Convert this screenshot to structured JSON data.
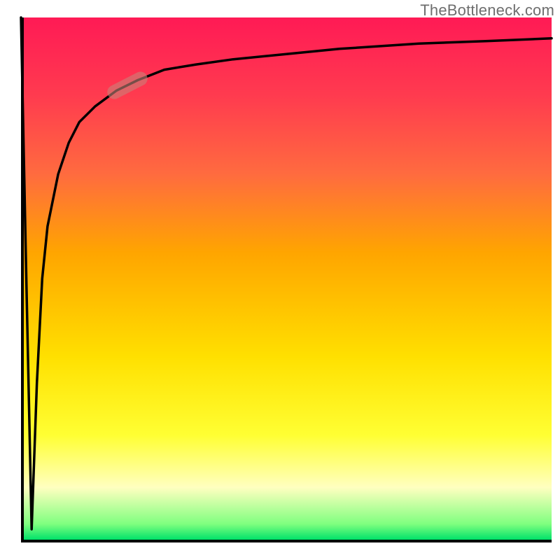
{
  "source_label": "TheBottleneck.com",
  "colors": {
    "gradient_top": "#ff1a55",
    "gradient_mid": "#ffe000",
    "gradient_bottom": "#00e26a",
    "axis": "#000000",
    "curve": "#000000",
    "marker": "rgba(200,130,120,0.6)"
  },
  "chart_data": {
    "type": "line",
    "title": "",
    "xlabel": "",
    "ylabel": "",
    "xlim": [
      0,
      100
    ],
    "ylim": [
      0,
      100
    ],
    "x": [
      0,
      1,
      2,
      3,
      4,
      5,
      7,
      9,
      11,
      14,
      18,
      22,
      27,
      33,
      40,
      50,
      60,
      75,
      88,
      100
    ],
    "values": [
      100,
      50,
      2,
      30,
      50,
      60,
      70,
      76,
      80,
      83,
      86,
      88,
      90,
      91,
      92,
      93,
      94,
      95,
      95.5,
      96
    ],
    "annotations": [
      {
        "kind": "highlight-pill",
        "x": 20,
        "y": 87,
        "angle_deg": -27
      }
    ]
  }
}
